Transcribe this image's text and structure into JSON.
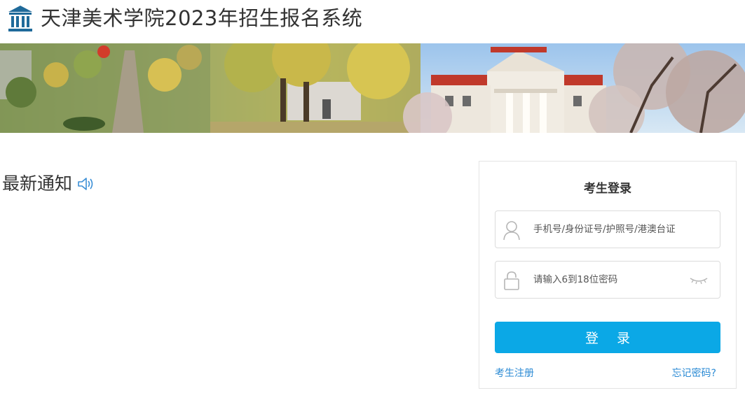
{
  "header": {
    "title": "天津美术学院2023年招生报名系统",
    "logo_icon": "museum-building-icon",
    "brand_color": "#1f6a9a"
  },
  "banner": {
    "icon": "campus-photo-banner"
  },
  "notice": {
    "title": "最新通知",
    "icon": "speaker-icon"
  },
  "login": {
    "title": "考生登录",
    "username": {
      "placeholder": "手机号/身份证号/护照号/港澳台证",
      "value": "",
      "icon": "user-icon"
    },
    "password": {
      "placeholder": "请输入6到18位密码",
      "value": "",
      "icon": "lock-icon",
      "toggle_icon": "eye-closed-icon"
    },
    "submit_label": "登 录",
    "register_link": "考生注册",
    "forgot_link": "忘记密码?",
    "accent_color": "#0ba8e6",
    "link_color": "#2a8ad4"
  }
}
